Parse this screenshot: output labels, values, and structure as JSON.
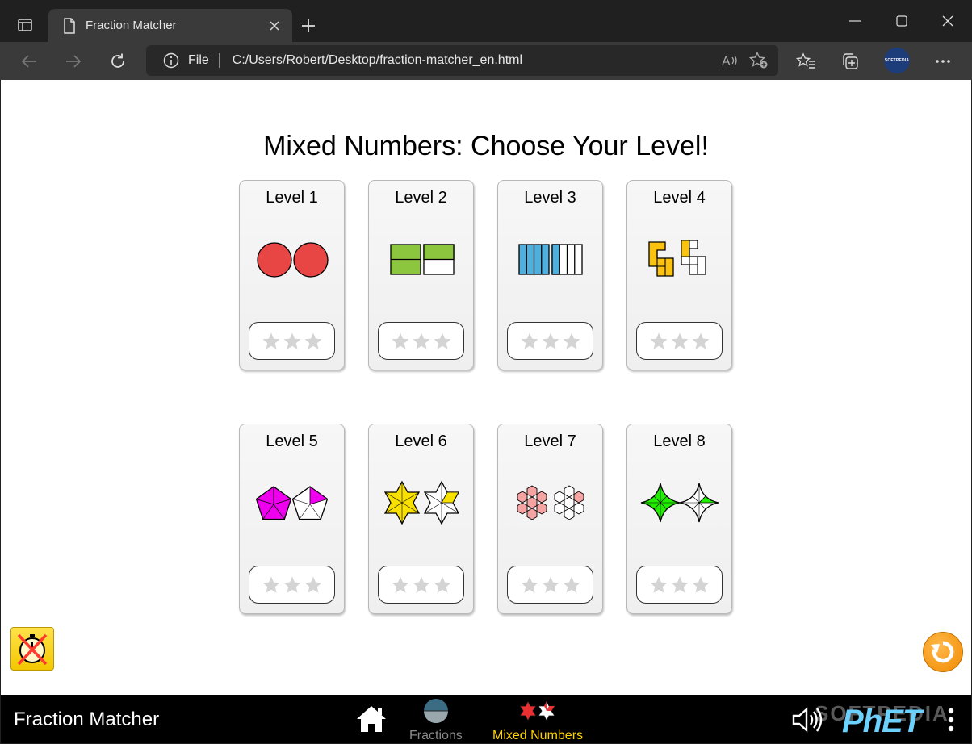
{
  "browser": {
    "tab_title": "Fraction Matcher",
    "address_scheme": "File",
    "address_url": "C:/Users/Robert/Desktop/fraction-matcher_en.html",
    "profile_badge": "SOFTPEDIA"
  },
  "page": {
    "title": "Mixed Numbers: Choose Your Level!",
    "levels": [
      {
        "label": "Level 1",
        "shape": "circles",
        "color": "#e84545",
        "stars_earned": 0,
        "stars_total": 3
      },
      {
        "label": "Level 2",
        "shape": "green-rects",
        "color": "#8cc63f",
        "stars_earned": 0,
        "stars_total": 3
      },
      {
        "label": "Level 3",
        "shape": "blue-bars",
        "color": "#4fb0de",
        "stars_earned": 0,
        "stars_total": 3
      },
      {
        "label": "Level 4",
        "shape": "yellow-tetris",
        "color": "#f9c30f",
        "stars_earned": 0,
        "stars_total": 3
      },
      {
        "label": "Level 5",
        "shape": "pentagons",
        "color": "#ee00ee",
        "stars_earned": 0,
        "stars_total": 3
      },
      {
        "label": "Level 6",
        "shape": "hexagrams",
        "color": "#f8e000",
        "stars_earned": 0,
        "stars_total": 3
      },
      {
        "label": "Level 7",
        "shape": "hex-clusters",
        "color": "#f6a3a3",
        "stars_earned": 0,
        "stars_total": 3
      },
      {
        "label": "Level 8",
        "shape": "four-point-stars",
        "color": "#22ee00",
        "stars_earned": 0,
        "stars_total": 3
      }
    ]
  },
  "navbar": {
    "sim_title": "Fraction Matcher",
    "screens": [
      {
        "label": "Fractions",
        "selected": false
      },
      {
        "label": "Mixed Numbers",
        "selected": true
      }
    ],
    "watermark": "SOFTPEDIA",
    "logo_text": "PhET"
  },
  "colors": {
    "star_empty": "#d4d4d4",
    "selected_screen": "#ffd200",
    "phet_blue": "#6bd1ff",
    "reset_orange": "#f08a00"
  }
}
